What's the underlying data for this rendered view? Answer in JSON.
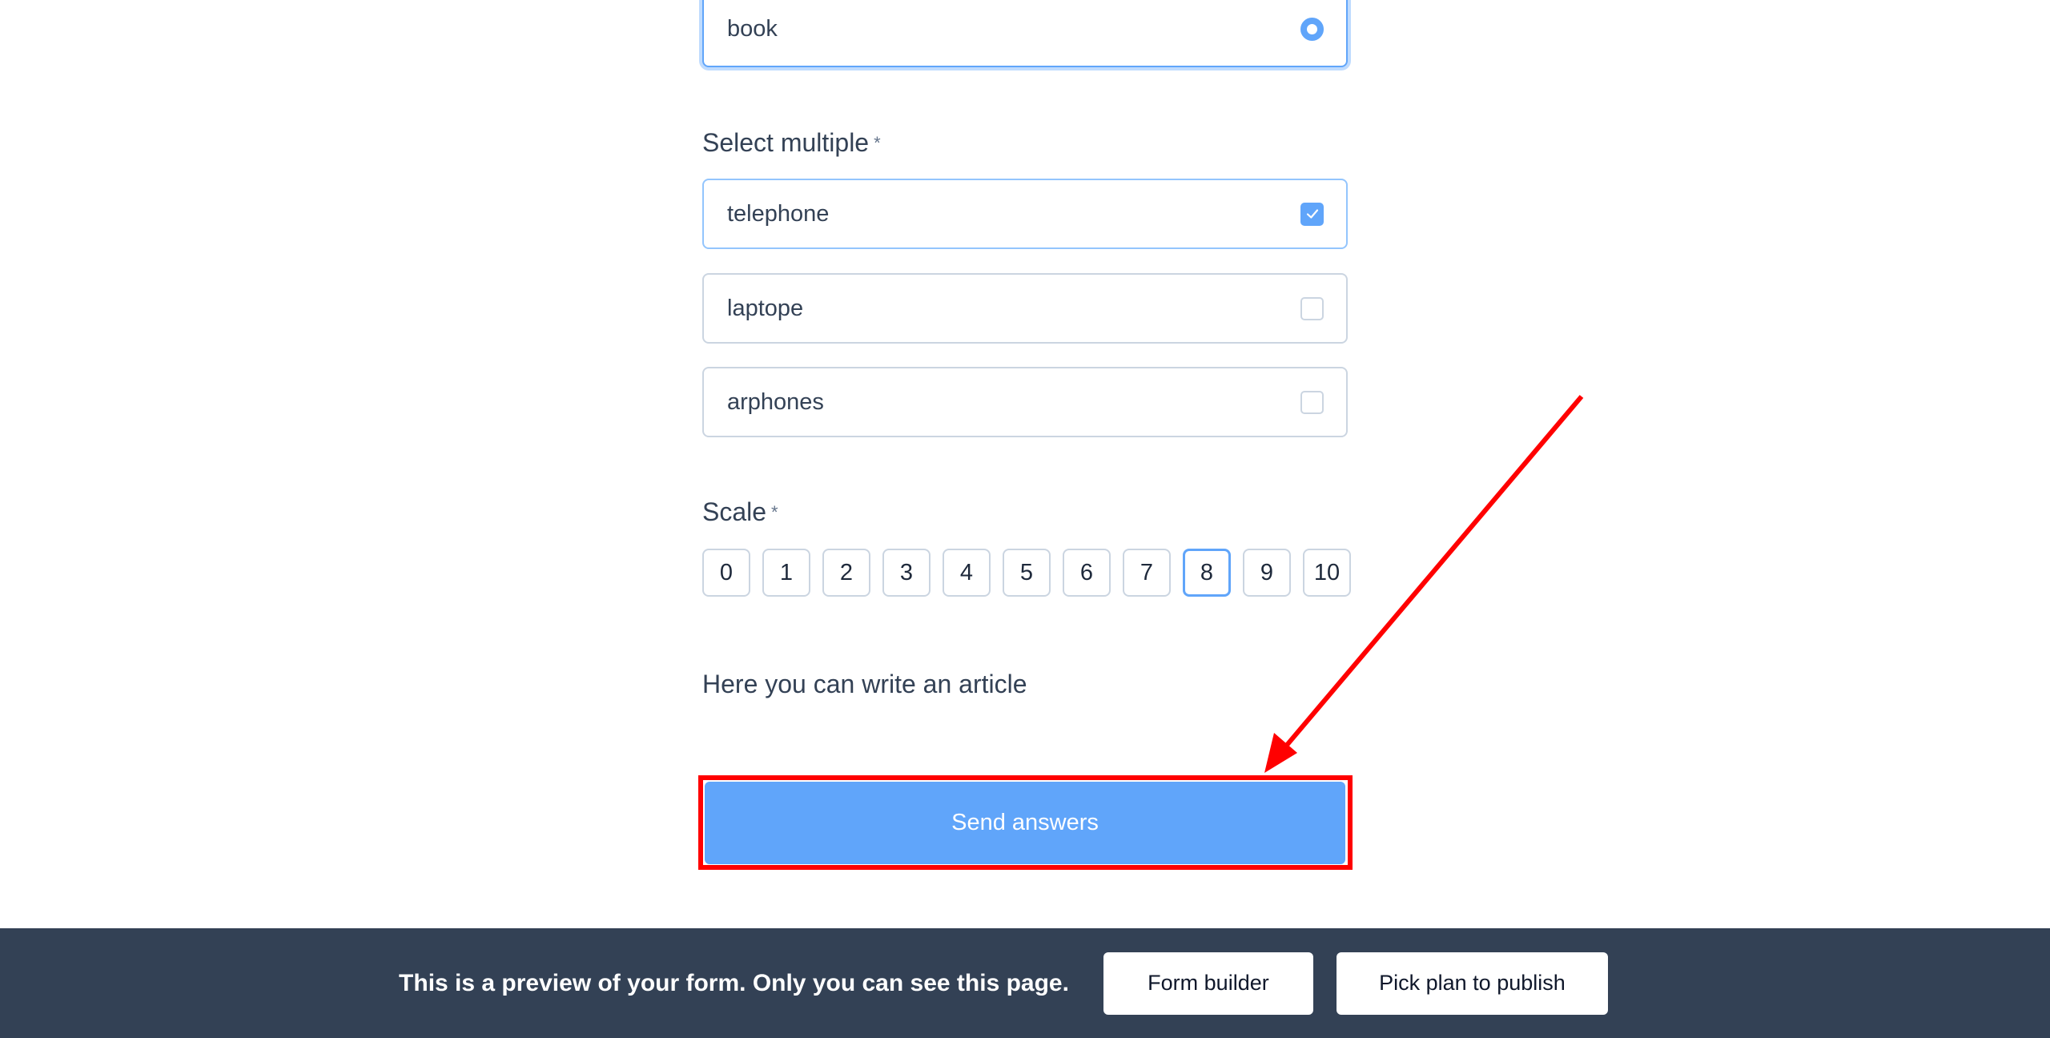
{
  "single_choice": {
    "selected_option": {
      "label": "book",
      "state": "selected"
    }
  },
  "select_multiple": {
    "label": "Select multiple",
    "required_marker": "*",
    "options": [
      {
        "label": "telephone",
        "checked": true
      },
      {
        "label": "laptope",
        "checked": false
      },
      {
        "label": "arphones",
        "checked": false
      }
    ]
  },
  "scale": {
    "label": "Scale",
    "required_marker": "*",
    "values": [
      "0",
      "1",
      "2",
      "3",
      "4",
      "5",
      "6",
      "7",
      "8",
      "9",
      "10"
    ],
    "selected": "8"
  },
  "article": {
    "text": "Here you can write an article"
  },
  "submit": {
    "label": "Send answers"
  },
  "annotation": {
    "highlight_color": "#ff0000",
    "target": "send-answers-button"
  },
  "footer": {
    "message": "This is a preview of your form. Only you can see this page.",
    "form_builder_label": "Form builder",
    "publish_label": "Pick plan to publish"
  },
  "colors": {
    "accent": "#60a5fa",
    "footer_bg": "#334155",
    "text": "#334155",
    "border": "#cbd5e1"
  }
}
